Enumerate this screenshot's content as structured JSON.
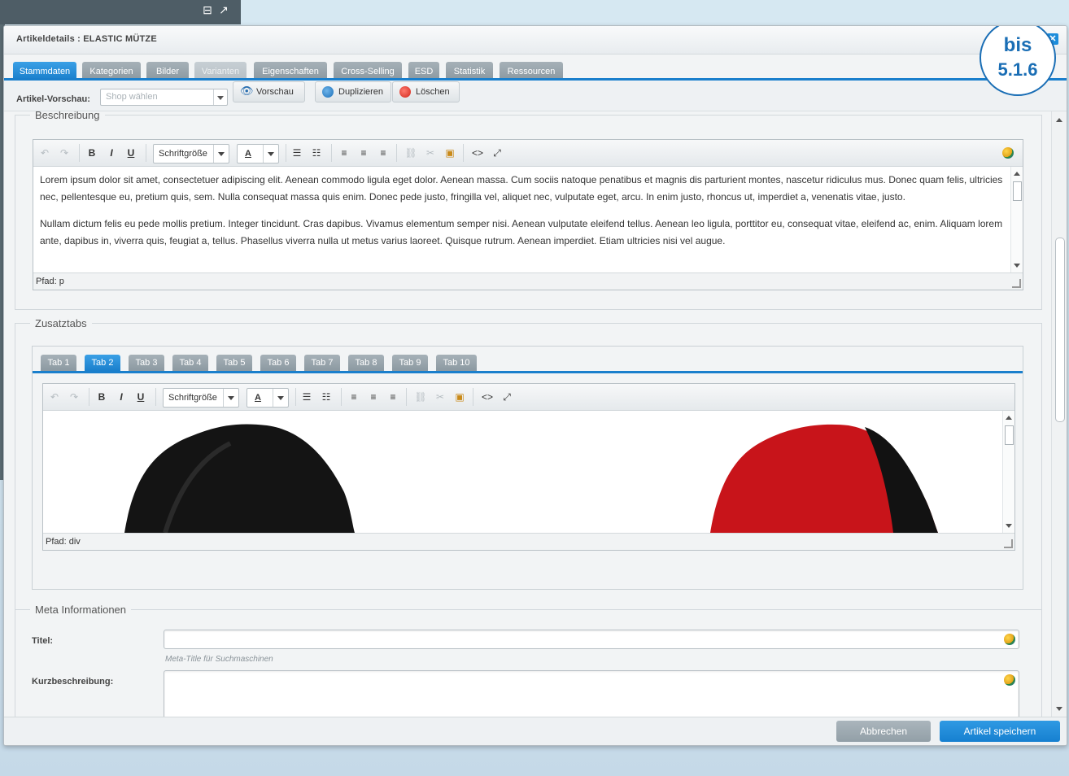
{
  "window": {
    "title": "Artikeldetails : ELASTIC MÜTZE",
    "close_label": "✕"
  },
  "badge": {
    "line1": "bis",
    "line2": "5.1.6"
  },
  "tabs": [
    {
      "label": "Stammdaten",
      "state": "active"
    },
    {
      "label": "Kategorien",
      "state": "normal"
    },
    {
      "label": "Bilder",
      "state": "normal"
    },
    {
      "label": "Varianten",
      "state": "disabled"
    },
    {
      "label": "Eigenschaften",
      "state": "normal"
    },
    {
      "label": "Cross-Selling",
      "state": "normal"
    },
    {
      "label": "ESD",
      "state": "normal"
    },
    {
      "label": "Statistik",
      "state": "normal"
    },
    {
      "label": "Ressourcen",
      "state": "normal"
    }
  ],
  "toolbar": {
    "preview_label": "Artikel-Vorschau:",
    "shop_placeholder": "Shop wählen",
    "preview_button": "Vorschau",
    "duplicate_button": "Duplizieren",
    "delete_button": "Löschen"
  },
  "beschreibung": {
    "legend": "Beschreibung",
    "font_size_label": "Schriftgröße",
    "paragraphs": [
      "Lorem ipsum dolor sit amet, consectetuer adipiscing elit. Aenean commodo ligula eget dolor. Aenean massa. Cum sociis natoque penatibus et magnis dis parturient montes, nascetur ridiculus mus. Donec quam felis, ultricies nec, pellentesque eu, pretium quis, sem. Nulla consequat massa quis enim. Donec pede justo, fringilla vel, aliquet nec, vulputate eget, arcu. In enim justo, rhoncus ut, imperdiet a, venenatis vitae, justo.",
      "Nullam dictum felis eu pede mollis pretium. Integer tincidunt. Cras dapibus. Vivamus elementum semper nisi. Aenean vulputate eleifend tellus. Aenean leo ligula, porttitor eu, consequat vitae, eleifend ac, enim. Aliquam lorem ante, dapibus in, viverra quis, feugiat a, tellus. Phasellus viverra nulla ut metus varius laoreet. Quisque rutrum. Aenean imperdiet. Etiam ultricies nisi vel augue."
    ],
    "path": "Pfad: p"
  },
  "zusatztabs": {
    "legend": "Zusatztabs",
    "tabs": [
      "Tab 1",
      "Tab 2",
      "Tab 3",
      "Tab 4",
      "Tab 5",
      "Tab 6",
      "Tab 7",
      "Tab 8",
      "Tab 9",
      "Tab 10"
    ],
    "active_tab": "Tab 2",
    "font_size_label": "Schriftgröße",
    "path": "Pfad: div"
  },
  "meta": {
    "legend": "Meta Informationen",
    "title_label": "Titel:",
    "title_value": "",
    "title_hint": "Meta-Title für Suchmaschinen",
    "short_label": "Kurzbeschreibung:",
    "short_value": ""
  },
  "footer": {
    "cancel": "Abbrechen",
    "save": "Artikel speichern"
  },
  "colors": {
    "accent": "#1a7fcc",
    "tab_inactive": "#9aa6ad",
    "cancel_btn": "#9aa6ad",
    "save_btn": "#1a8ad8"
  },
  "icons": [
    "undo-icon",
    "redo-icon",
    "bold-icon",
    "italic-icon",
    "underline-icon",
    "text-color-icon",
    "bullet-list-icon",
    "numbered-list-icon",
    "align-left-icon",
    "align-center-icon",
    "align-right-icon",
    "link-icon",
    "unlink-icon",
    "media-icon",
    "code-icon",
    "fullscreen-icon",
    "globe-icon",
    "eye-icon",
    "duplicate-icon",
    "delete-icon"
  ]
}
